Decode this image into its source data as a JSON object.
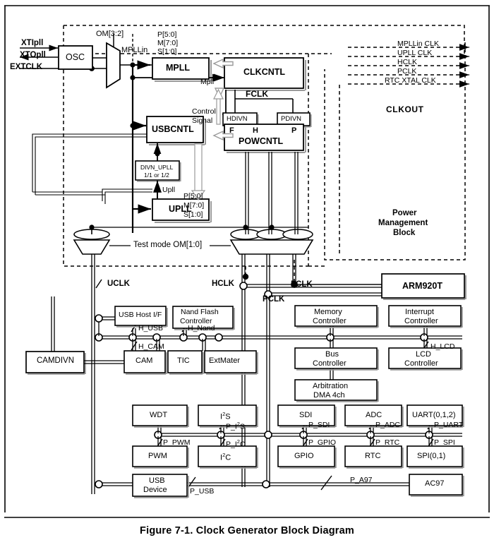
{
  "figure": {
    "caption": "Figure 7-1. Clock Generator Block Diagram",
    "title": "Clock Generator Block Diagram"
  },
  "inputs": {
    "xtipll": "XTIpll",
    "xtopll": "XTOpll",
    "extclk": "EXTCLK"
  },
  "blocks": {
    "osc": "OSC",
    "mpll": "MPLL",
    "clkcntl": "CLKCNTL",
    "usbcntl": "USBCNTL",
    "upll": "UPLL",
    "powcntl": "POWCNTL",
    "hdivn": "HDIVN",
    "pdivn": "PDIVN",
    "divn_upll_l1": "DIVN_UPLL",
    "divn_upll_l2": "1/1 or 1/2",
    "arm920t": "ARM920T",
    "camdivn": "CAMDIVN",
    "usb_host": "USB Host I/F",
    "nand_l1": "Nand Flash",
    "nand_l2": "Controller",
    "cam": "CAM",
    "tic": "TIC",
    "extmater": "ExtMater",
    "mem_l1": "Memory",
    "mem_l2": "Controller",
    "int_l1": "Interrupt",
    "int_l2": "Controller",
    "bus_l1": "Bus",
    "bus_l2": "Controller",
    "lcd_l1": "LCD",
    "lcd_l2": "Controller",
    "arb_l1": "Arbitration",
    "arb_l2": "DMA 4ch",
    "wdt": "WDT",
    "i2s": "I2S",
    "sdi": "SDI",
    "adc": "ADC",
    "uart": "UART(0,1,2)",
    "pwm": "PWM",
    "i2c": "I2C",
    "gpio": "GPIO",
    "rtc": "RTC",
    "spi": "SPI(0,1)",
    "usb_dev_l1": "USB",
    "usb_dev_l2": "Device",
    "ac97": "AC97"
  },
  "labels": {
    "om32": "OM[3:2]",
    "mpllin": "MPLLin",
    "mpll_param_p": "P[5:0]",
    "mpll_param_m": "M[7:0]",
    "mpll_param_s": "S[1:0]",
    "upll_param_p": "P[5:0]",
    "upll_param_m": "M[7:0]",
    "upll_param_s": "S[1:0]",
    "mpll_out": "Mpll",
    "upll_out": "Upll",
    "control_l1": "Control",
    "control_l2": "Signal",
    "fclk_tag": "FCLK",
    "pow_f": "F",
    "pow_h": "H",
    "pow_p": "P",
    "clkout": "CLKOUT",
    "pmb_l1": "Power",
    "pmb_l2": "Management",
    "pmb_l3": "Block",
    "testmode": "Test mode OM[1:0]",
    "uclk": "UCLK",
    "hclk": "HCLK",
    "fclk": "FCLK",
    "pclk": "PCLK"
  },
  "outputs": [
    {
      "name": "MPLLin CLK"
    },
    {
      "name": "UPLL CLK"
    },
    {
      "name": "HCLK"
    },
    {
      "name": "PCLK"
    },
    {
      "name": "RTC XTAL CLK"
    }
  ],
  "bus_taps": {
    "h_usb": "H_USB",
    "h_cam": "H_CAM",
    "h_nand": "H_Nand",
    "h_lcd": "H_LCD",
    "p_pwm": "P_PWM",
    "p_i2s": "P_I2S",
    "p_i2c": "P_I2C",
    "p_sdi": "P_SDI",
    "p_gpio": "P_GPIO",
    "p_adc": "P_ADC",
    "p_rtc": "P_RTC",
    "p_uart": "P_UART",
    "p_spi": "P_SPI",
    "p_usb": "P_USB",
    "p_a97": "P_A97"
  },
  "colors": {
    "line": "#000000",
    "background": "#ffffff",
    "box_border": "#000000",
    "shadow": "#999999"
  }
}
